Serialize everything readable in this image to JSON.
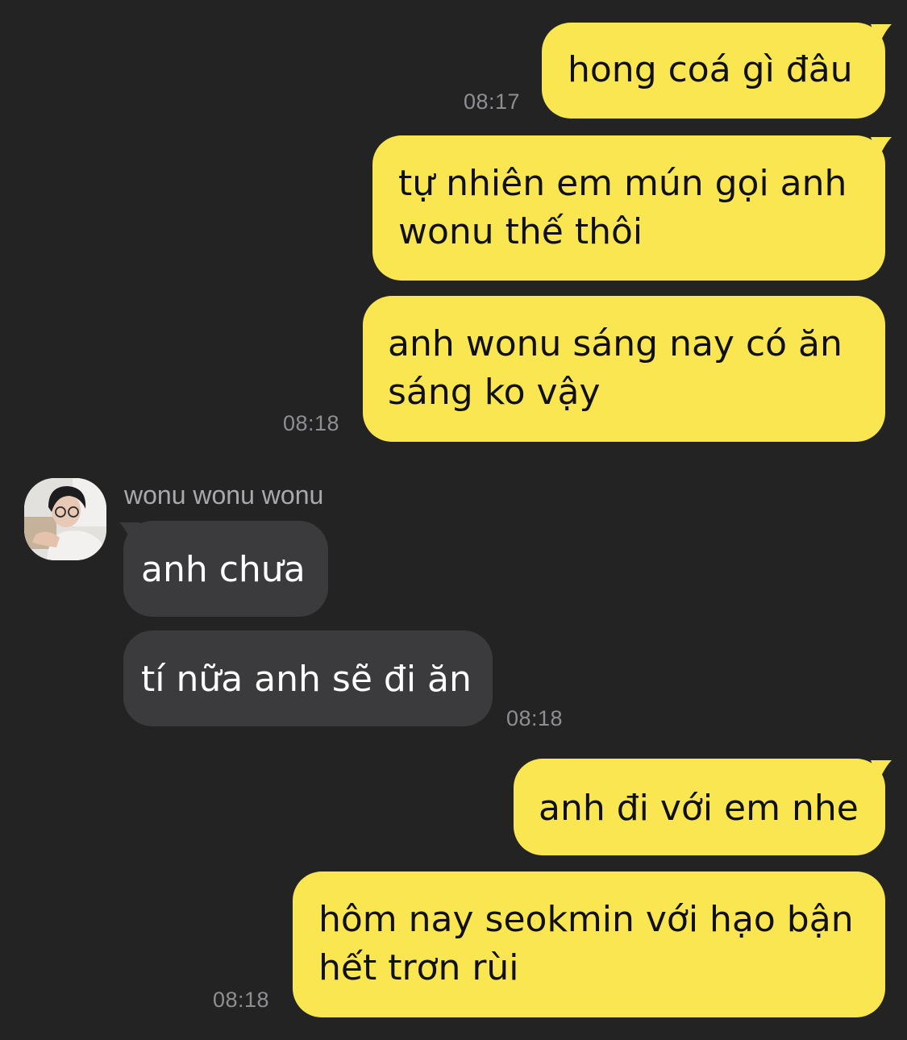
{
  "chat": {
    "messages": [
      {
        "id": "m1",
        "direction": "outgoing",
        "lines": [
          "hong coá gì đâu"
        ],
        "time": "08:17"
      },
      {
        "id": "m2",
        "direction": "outgoing",
        "lines": [
          "tự nhiên em mún gọi anh",
          "wonu thế thôi"
        ],
        "time": ""
      },
      {
        "id": "m3",
        "direction": "outgoing",
        "lines": [
          "anh wonu sáng nay có ăn",
          "sáng ko vậy"
        ],
        "time": "08:18"
      },
      {
        "id": "m4",
        "direction": "incoming",
        "sender": "wonu wonu wonu",
        "lines": [
          "anh chưa"
        ],
        "time": ""
      },
      {
        "id": "m5",
        "direction": "incoming",
        "lines": [
          "tí nữa anh sẽ đi ăn"
        ],
        "time": "08:18"
      },
      {
        "id": "m6",
        "direction": "outgoing",
        "lines": [
          "anh đi với em nhe"
        ],
        "time": ""
      },
      {
        "id": "m7",
        "direction": "outgoing",
        "lines": [
          "hôm nay seokmin với hạo bận",
          "hết trơn rùi"
        ],
        "time": "08:18"
      }
    ]
  },
  "colors": {
    "background": "#232323",
    "outgoing_bubble": "#f9e651",
    "incoming_bubble": "#3b3b3d",
    "timestamp": "#8e8e93"
  }
}
